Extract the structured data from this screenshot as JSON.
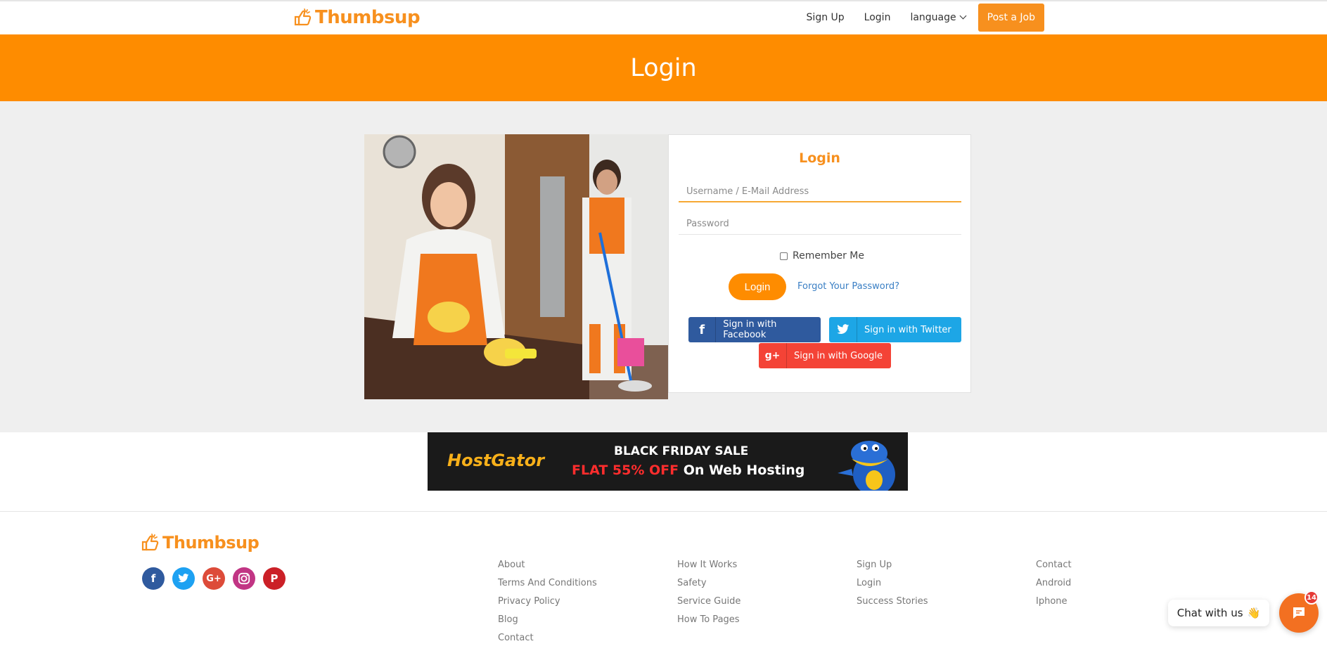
{
  "brand": {
    "name": "Thumbsup",
    "accent": "#fe8c00",
    "link": "#3a7fc4"
  },
  "nav": {
    "signup": "Sign Up",
    "login": "Login",
    "language": "language",
    "post_job": "Post a Job"
  },
  "banner": {
    "title": "Login"
  },
  "login_card": {
    "title": "Login",
    "username_placeholder": "Username / E-Mail Address",
    "password_placeholder": "Password",
    "remember": "Remember Me",
    "submit": "Login",
    "forgot": "Forgot Your Password?",
    "facebook": "Sign in with Facebook",
    "twitter": "Sign in with Twitter",
    "google": "Sign in with Google"
  },
  "ad": {
    "brand": "HostGator",
    "line1": "BLACK FRIDAY SALE",
    "line2_highlight": "FLAT 55% OFF",
    "line2_rest": "On Web Hosting"
  },
  "footer": {
    "social": [
      "facebook-icon",
      "twitter-icon",
      "google-plus-icon",
      "instagram-icon",
      "pinterest-icon"
    ],
    "col1": [
      "About",
      "Terms And Conditions",
      "Privacy Policy",
      "Blog",
      "Contact"
    ],
    "col2": [
      "How It Works",
      "Safety",
      "Service Guide",
      "How To Pages"
    ],
    "col3": [
      "Sign Up",
      "Login",
      "Success Stories"
    ],
    "col4": [
      "Contact",
      "Android",
      "Iphone"
    ]
  },
  "chat": {
    "label": "Chat with us",
    "badge": "14"
  }
}
